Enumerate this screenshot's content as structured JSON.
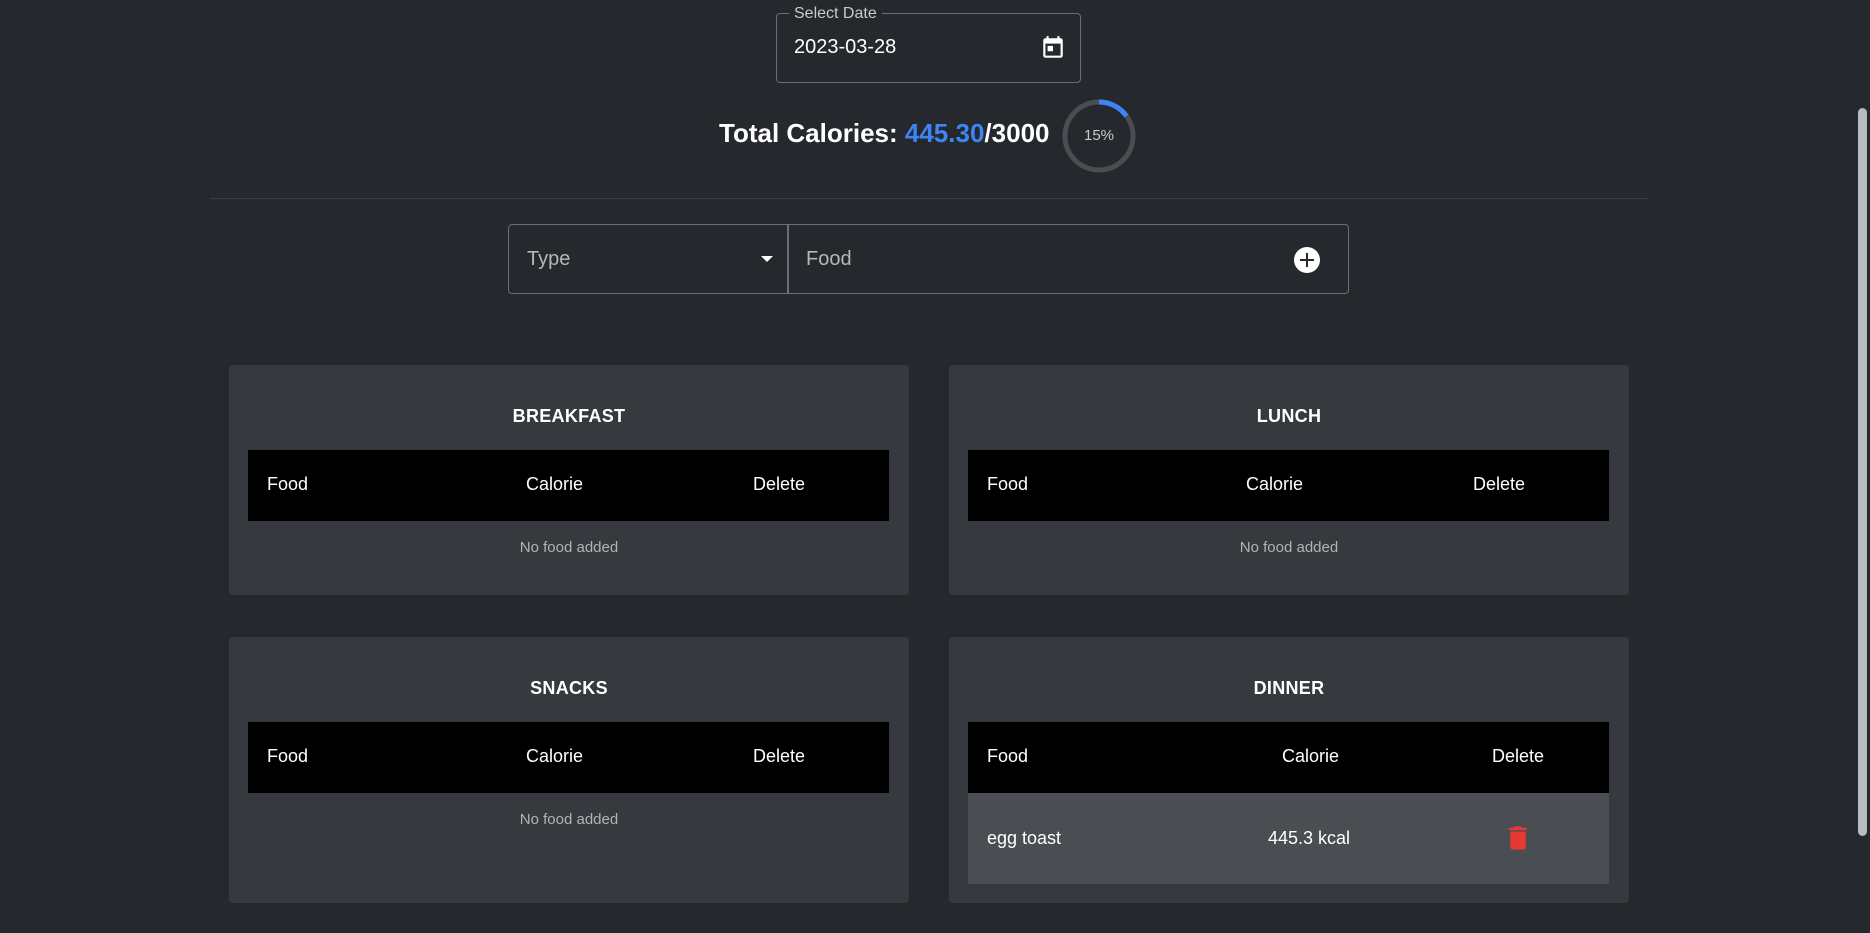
{
  "date_picker": {
    "label": "Select Date",
    "value": "2023-03-28",
    "icon": "calendar-icon"
  },
  "totals": {
    "label": "Total Calories: ",
    "current": "445.30",
    "separator": "/",
    "goal": "3000",
    "percent_label": "15%",
    "percent": 15
  },
  "add_form": {
    "type_placeholder": "Type",
    "food_placeholder": "Food",
    "add_icon": "add-circle-icon"
  },
  "meals": {
    "breakfast": {
      "title": "BREAKFAST",
      "columns": [
        "Food",
        "Calorie",
        "Delete"
      ],
      "empty": "No food added"
    },
    "lunch": {
      "title": "LUNCH",
      "columns": [
        "Food",
        "Calorie",
        "Delete"
      ],
      "empty": "No food added"
    },
    "snacks": {
      "title": "SNACKS",
      "columns": [
        "Food",
        "Calorie",
        "Delete"
      ],
      "empty": "No food added"
    },
    "dinner": {
      "title": "DINNER",
      "columns": [
        "Food",
        "Calorie",
        "Delete"
      ],
      "rows": [
        {
          "food": "egg toast",
          "calorie": "445.3 kcal"
        }
      ]
    }
  },
  "colors": {
    "background": "#25282c",
    "card": "#36393d",
    "accent": "#3d84f5",
    "delete": "#e53935"
  }
}
